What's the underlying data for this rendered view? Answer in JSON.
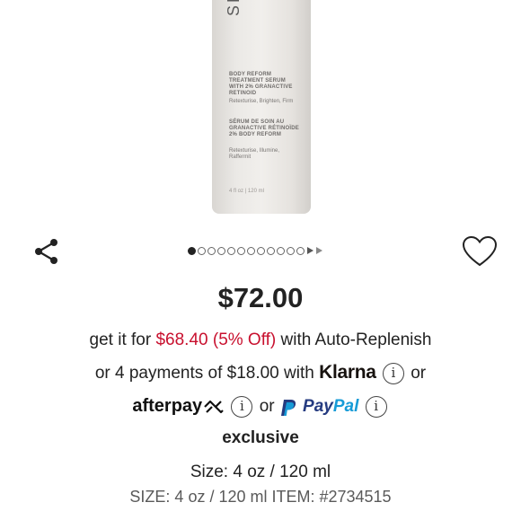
{
  "product_image": {
    "brand_partial": "SH",
    "name_en": "BODY REFORM TREATMENT SERUM WITH 2% GRANACTIVE RETINOID",
    "desc_en": "Retexturise, Brighten, Firm",
    "name_fr": "SÉRUM DE SOIN AU GRANACTIVE RÉTINOÏDE 2% BODY REFORM",
    "desc_fr": "Retexturise, Illumine, Raffermit",
    "size": "4 fl oz | 120 ml"
  },
  "carousel": {
    "dot_count": 12,
    "active_index": 0
  },
  "pricing": {
    "price": "$72.00",
    "autoreplenish_prefix": "get it for",
    "autoreplenish_price": "$68.40 (5% Off)",
    "autoreplenish_suffix": "with Auto-Replenish",
    "installments_text": "or 4 payments of $18.00 with",
    "klarna_label": "Klarna",
    "or_1": "or",
    "afterpay_label": "afterpay",
    "or_2": "or",
    "paypal_label_1": "Pay",
    "paypal_label_2": "Pal",
    "info_glyph": "i"
  },
  "badge": {
    "exclusive": "exclusive"
  },
  "details": {
    "size_text": "Size: 4 oz / 120 ml",
    "size_item_text": "SIZE: 4 oz / 120 ml ITEM: #2734515"
  },
  "icons": {
    "share": "share-icon",
    "wishlist": "heart-icon"
  },
  "colors": {
    "sale_red": "#c8102e",
    "paypal_blue": "#253b80",
    "paypal_light": "#179bd7"
  }
}
